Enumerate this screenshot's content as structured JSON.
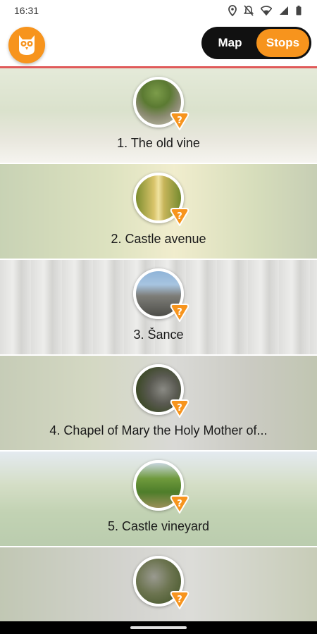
{
  "status_bar": {
    "time": "16:31",
    "icons": [
      "location-icon",
      "notifications-off-icon",
      "wifi-icon",
      "signal-icon",
      "battery-icon"
    ]
  },
  "app_bar": {
    "logo_icon": "owl-logo-icon",
    "toggle": [
      {
        "label": "Map",
        "active": false
      },
      {
        "label": "Stops",
        "active": true
      }
    ]
  },
  "colors": {
    "accent": "#f7941d",
    "toggle_bg": "#111111",
    "header_rule": "#e05a5a"
  },
  "stops": [
    {
      "title": "1. The old vine",
      "badge_icon": "question-icon"
    },
    {
      "title": "2. Castle avenue",
      "badge_icon": "question-icon"
    },
    {
      "title": "3. Šance",
      "badge_icon": "question-icon"
    },
    {
      "title": "4. Chapel of Mary the Holy Mother of...",
      "badge_icon": "question-icon"
    },
    {
      "title": "5. Castle vineyard",
      "badge_icon": "question-icon"
    },
    {
      "title": "",
      "badge_icon": "question-icon"
    }
  ]
}
